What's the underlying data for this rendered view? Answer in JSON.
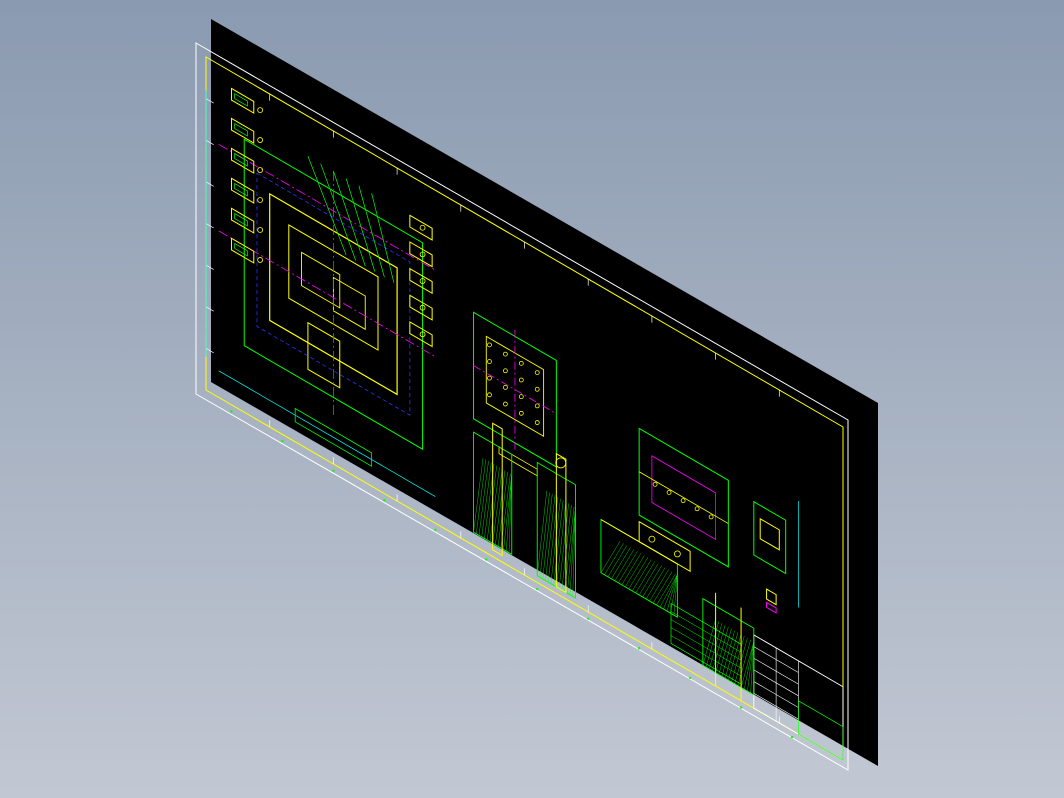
{
  "viewport": {
    "background_top": "#8a9ab0",
    "background_bottom": "#c2c8d3"
  },
  "drawing_sheet": {
    "sheet_color": "#000000",
    "border_color": "#ffffff",
    "inner_border_color": "#ffff00",
    "line_colors": {
      "primary": "#00ff00",
      "secondary": "#ffff00",
      "center": "#ff00ff",
      "hidden": "#3030ff",
      "dimension": "#00ffff",
      "text": "#ffffff"
    }
  }
}
